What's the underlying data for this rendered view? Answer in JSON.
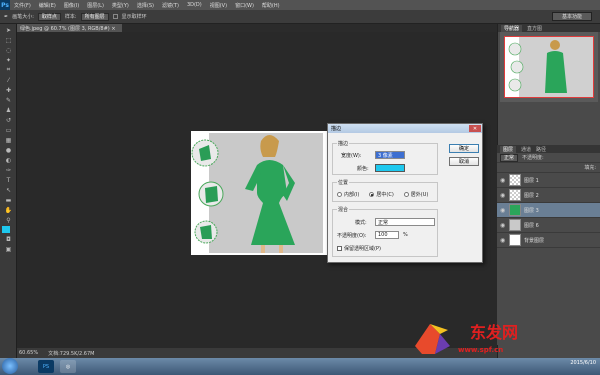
{
  "menu": [
    "文件(F)",
    "编辑(E)",
    "图像(I)",
    "图层(L)",
    "类型(Y)",
    "选择(S)",
    "滤镜(T)",
    "3D(D)",
    "视图(V)",
    "窗口(W)",
    "帮助(H)"
  ],
  "options": {
    "size_label": "画笔大小:",
    "size_value": "取样点",
    "sample_label": "样本:",
    "sample_value": "所有图层",
    "show_ring": "显示取样环",
    "essentials": "基本功能"
  },
  "doc_tab": "绿色.jpeg @ 60.7% (图层 3, RGB/8#) ×",
  "status": {
    "zoom": "60.65%",
    "doc": "文档:729.5K/2.67M"
  },
  "nav_tabs": [
    "导航器",
    "直方图"
  ],
  "layers_tabs": [
    "图层",
    "通道",
    "路径"
  ],
  "layer_blend": "正常",
  "layer_opacity_label": "不透明度:",
  "layer_fill_label": "填充:",
  "layers": [
    {
      "name": "图层 1"
    },
    {
      "name": "图层 2"
    },
    {
      "name": "图层 3"
    },
    {
      "name": "图层 6"
    },
    {
      "name": "背景图层"
    }
  ],
  "dialog": {
    "title": "描边",
    "stroke_group": "描边",
    "width_label": "宽度(W):",
    "width_value": "3 像素",
    "color_label": "颜色:",
    "stroke_color": "#1ec8ee",
    "position_group": "位置",
    "positions": [
      "内部(I)",
      "居中(C)",
      "居外(U)"
    ],
    "blend_group": "混合",
    "mode_label": "模式:",
    "mode_value": "正常",
    "opacity_label": "不透明度(O):",
    "opacity_value": "100",
    "percent": "%",
    "preserve": "保留透明区域(P)",
    "ok": "确定",
    "cancel": "取消"
  },
  "taskbar": {
    "ps": "PS",
    "time": "",
    "date": "2015/6/10"
  },
  "watermark": "www.spf.cn"
}
